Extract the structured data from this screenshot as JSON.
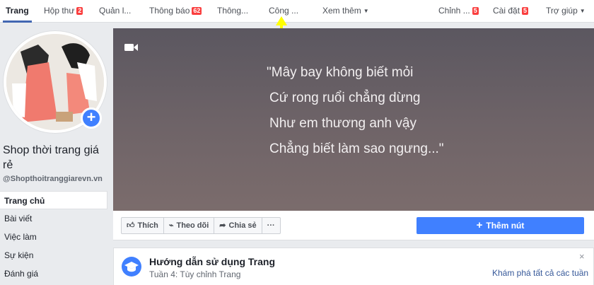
{
  "nav": {
    "trang": "Trang",
    "hop_thu": "Hộp thư",
    "hop_thu_badge": "2",
    "quan_ly": "Quản l...",
    "thong_bao": "Thông báo",
    "thong_bao_badge": "62",
    "thong_ke": "Thông...",
    "cong_cu": "Công ...",
    "xem_them": "Xem thêm",
    "chinh_sua": "Chỉnh ...",
    "chinh_sua_badge": "5",
    "cai_dat": "Cài đặt",
    "cai_dat_badge": "5",
    "tro_giup": "Trợ giúp"
  },
  "page": {
    "name": "Shop thời trang giá rẻ",
    "handle": "@Shopthoitranggiarevn.vn"
  },
  "menu": [
    "Trang chủ",
    "Bài viết",
    "Việc làm",
    "Sự kiện",
    "Đánh giá"
  ],
  "cover": {
    "lines": [
      "\"Mây bay không biết mỏi",
      "Cứ rong ruổi chẳng dừng",
      "Như em thương anh vậy",
      "Chẳng biết làm sao ngưng...\""
    ]
  },
  "actions": {
    "like": "Thích",
    "follow": "Theo dõi",
    "share": "Chia sẻ",
    "more": "···",
    "add_button": "Thêm nút"
  },
  "guide": {
    "title": "Hướng dẫn sử dụng Trang",
    "subtitle": "Tuần 4: Tùy chỉnh Trang",
    "link": "Khám phá tất cả các tuần",
    "close": "×"
  },
  "colors": {
    "accent": "#4267b2",
    "button_blue": "#4080ff",
    "badge_red": "#fa3e3e",
    "arrow_yellow": "#ffff00"
  }
}
